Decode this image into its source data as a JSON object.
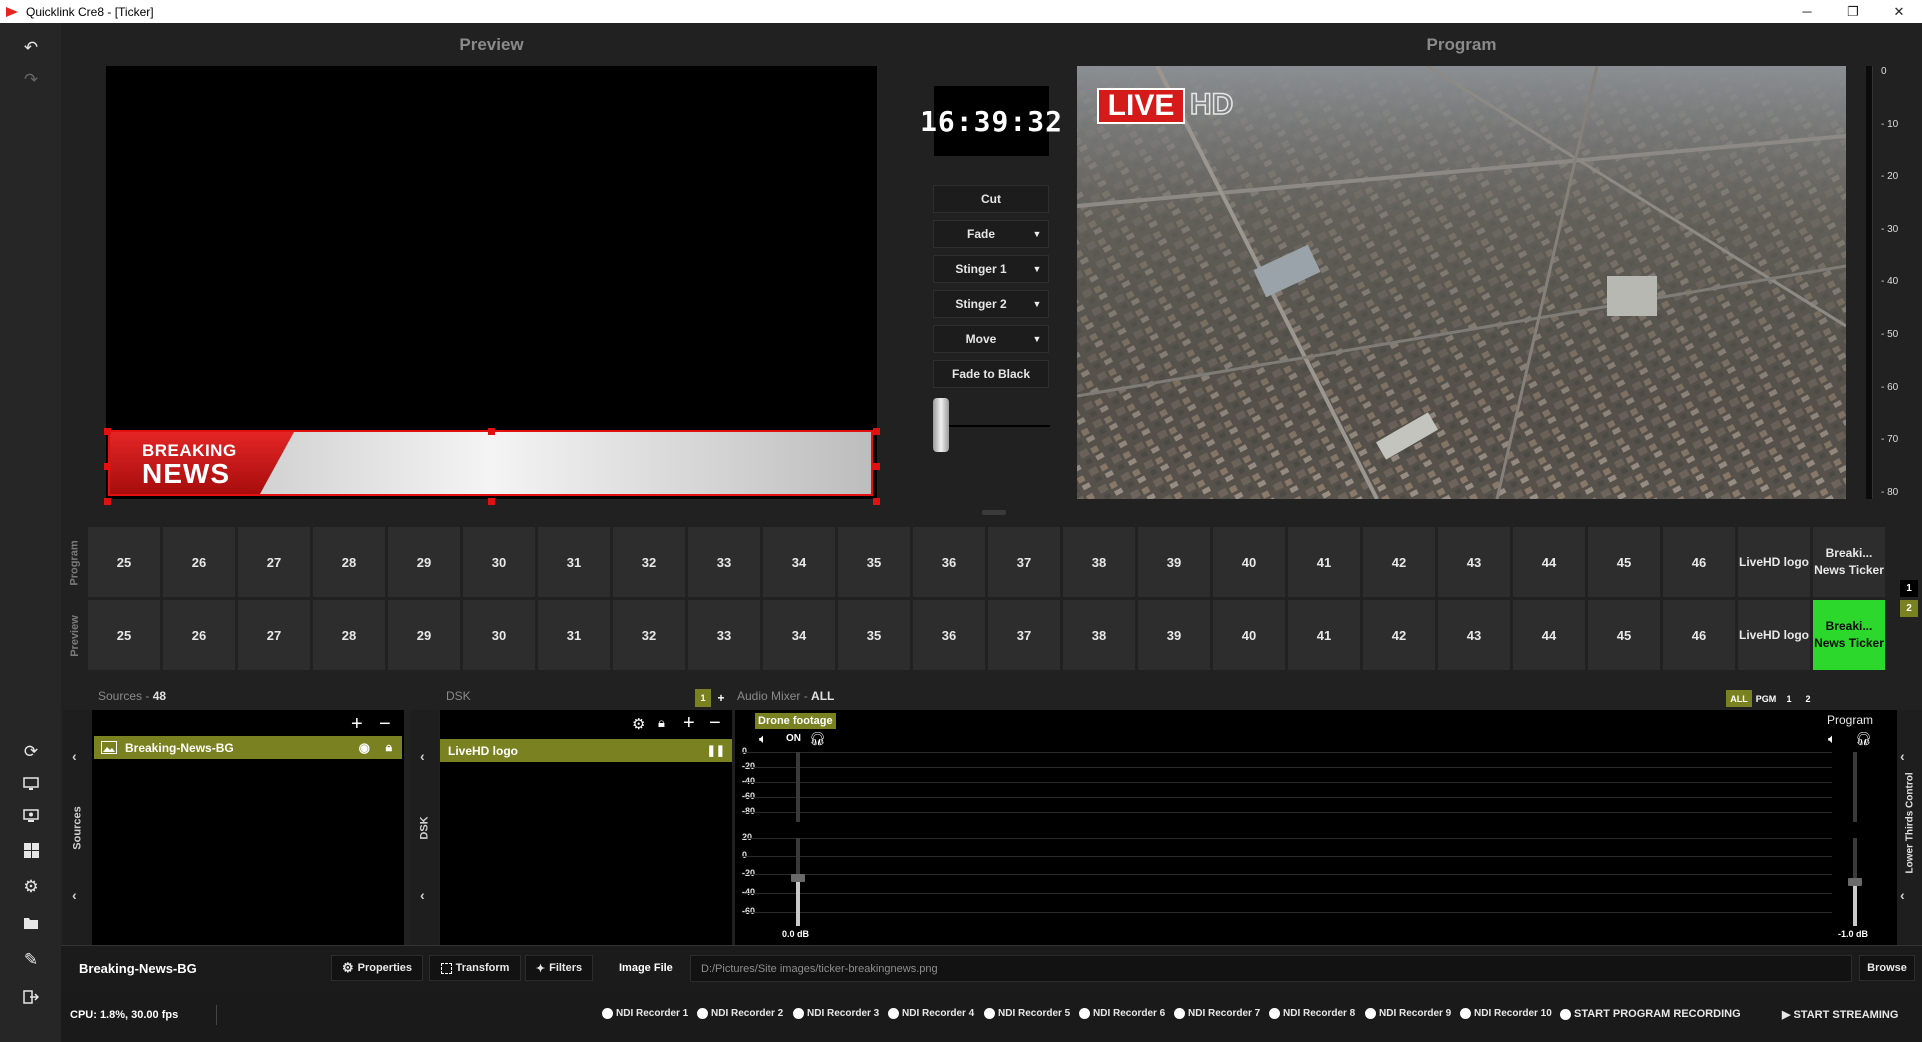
{
  "window": {
    "title": "Quicklink Cre8  - [Ticker]",
    "minimize": "─",
    "restore": "❐",
    "close": "✕"
  },
  "preview": {
    "title": "Preview",
    "breaking_line1": "BREAKING",
    "breaking_line2": "NEWS"
  },
  "program": {
    "title": "Program",
    "live_badge": "LIVE",
    "hd_badge": "HD"
  },
  "clock": "16:39:32",
  "transitions": [
    {
      "label": "Cut",
      "dropdown": false
    },
    {
      "label": "Fade",
      "dropdown": true
    },
    {
      "label": "Stinger 1",
      "dropdown": true
    },
    {
      "label": "Stinger 2",
      "dropdown": true
    },
    {
      "label": "Move",
      "dropdown": true
    },
    {
      "label": "Fade to Black",
      "dropdown": false
    }
  ],
  "meter_scale": [
    "0",
    "- 10",
    "- 20",
    "- 30",
    "- 40",
    "- 50",
    "- 60",
    "- 70",
    "- 80"
  ],
  "switcher": {
    "program_label": "Program",
    "preview_label": "Preview",
    "program_row": [
      "25",
      "26",
      "27",
      "28",
      "29",
      "30",
      "31",
      "32",
      "33",
      "34",
      "35",
      "36",
      "37",
      "38",
      "39",
      "40",
      "41",
      "42",
      "43",
      "44",
      "45",
      "46",
      "LiveHD logo",
      "Breaki... News Ticker"
    ],
    "preview_row": [
      "25",
      "26",
      "27",
      "28",
      "29",
      "30",
      "31",
      "32",
      "33",
      "34",
      "35",
      "36",
      "37",
      "38",
      "39",
      "40",
      "41",
      "42",
      "43",
      "44",
      "45",
      "46",
      "LiveHD logo",
      "Breaki... News Ticker"
    ],
    "preview_active_index": 23,
    "bus_numbers": [
      "1",
      "2"
    ]
  },
  "sources": {
    "label": "Sources",
    "count": "48",
    "side_label": "Sources",
    "items": [
      "Breaking-News-BG"
    ]
  },
  "dsk": {
    "label": "DSK",
    "side_label": "DSK",
    "badge": "1",
    "add": "+",
    "items": [
      "LiveHD logo"
    ]
  },
  "audio_mixer": {
    "label": "Audio Mixer",
    "filter": "ALL",
    "tabs": [
      "ALL",
      "PGM",
      "1",
      "2"
    ],
    "channel_name": "Drone footage",
    "channel_on": "ON",
    "channel_db": "0.0 dB",
    "program_name": "Program",
    "program_db": "-1.0 dB",
    "scale_top": [
      "0",
      "-20",
      "-40",
      "-60",
      "-80"
    ],
    "scale_bottom": [
      "20",
      "0",
      "-20",
      "-40",
      "-60"
    ],
    "channel_level": 0.55,
    "program_level": 0.5
  },
  "lower_thirds": {
    "label": "Lower Thirds Control"
  },
  "properties_bar": {
    "selected_name": "Breaking-News-BG",
    "properties": "Properties",
    "transform": "Transform",
    "filters": "Filters",
    "image_file_label": "Image File",
    "image_path": "D:/Pictures/Site images/ticker-breakingnews.png",
    "browse": "Browse"
  },
  "status": {
    "cpu": "CPU: 1.8%, 30.00 fps",
    "recorders": [
      "NDI Recorder 1",
      "NDI Recorder 2",
      "NDI Recorder 3",
      "NDI Recorder 4",
      "NDI Recorder 5",
      "NDI Recorder 6",
      "NDI Recorder 7",
      "NDI Recorder 8",
      "NDI Recorder 9",
      "NDI Recorder 10"
    ],
    "start_recording": "START PROGRAM RECORDING",
    "start_streaming": "START STREAMING"
  },
  "colors": {
    "accent_green": "#2bd82b",
    "olive": "#7a8120",
    "live_red": "#d51a1a"
  }
}
